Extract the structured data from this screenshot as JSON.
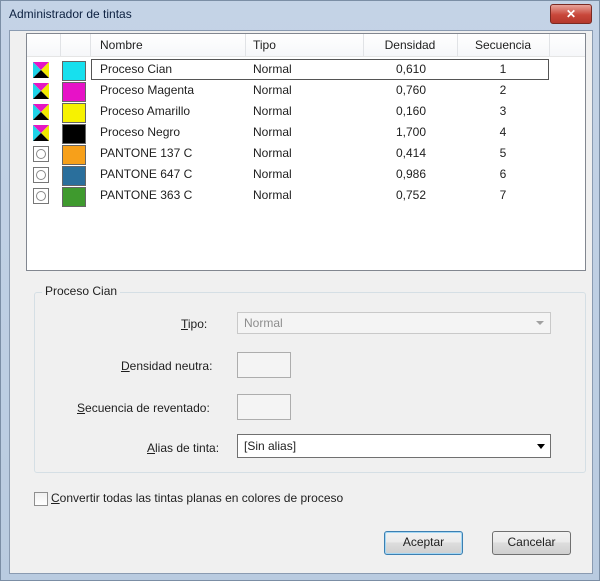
{
  "window": {
    "title": "Administrador de tintas",
    "close_label": "✕"
  },
  "ink_list": {
    "columns": [
      "Nombre",
      "Tipo",
      "Densidad",
      "Secuencia"
    ],
    "rows": [
      {
        "name": "Proceso Cian",
        "type": "Normal",
        "density": "0,610",
        "sequence": "1",
        "color": "#17e0ee",
        "kind": "process",
        "selected": true
      },
      {
        "name": "Proceso Magenta",
        "type": "Normal",
        "density": "0,760",
        "sequence": "2",
        "color": "#e712c7",
        "kind": "process"
      },
      {
        "name": "Proceso Amarillo",
        "type": "Normal",
        "density": "0,160",
        "sequence": "3",
        "color": "#f7f200",
        "kind": "process"
      },
      {
        "name": "Proceso Negro",
        "type": "Normal",
        "density": "1,700",
        "sequence": "4",
        "color": "#000000",
        "kind": "process"
      },
      {
        "name": "PANTONE 137 C",
        "type": "Normal",
        "density": "0,414",
        "sequence": "5",
        "color": "#f7a01a",
        "kind": "spot"
      },
      {
        "name": "PANTONE 647 C",
        "type": "Normal",
        "density": "0,986",
        "sequence": "6",
        "color": "#2a6f9c",
        "kind": "spot"
      },
      {
        "name": "PANTONE 363 C",
        "type": "Normal",
        "density": "0,752",
        "sequence": "7",
        "color": "#3f9a2e",
        "kind": "spot"
      }
    ]
  },
  "details": {
    "group_title": "Proceso Cian",
    "tipo_label_ul": "T",
    "tipo_label_rest": "ipo:",
    "tipo_value": "Normal",
    "densidad_label_ul": "D",
    "densidad_label_rest": "ensidad neutra:",
    "secuencia_label_ul": "S",
    "secuencia_label_rest": "ecuencia de reventado:",
    "alias_label_ul": "A",
    "alias_label_rest": "lias de tinta:",
    "alias_value": "[Sin alias]"
  },
  "convert_checkbox": {
    "label_ul": "C",
    "label_rest": "onvertir todas las tintas planas en colores de proceso",
    "checked": false
  },
  "buttons": {
    "ok": "Aceptar",
    "cancel": "Cancelar"
  }
}
